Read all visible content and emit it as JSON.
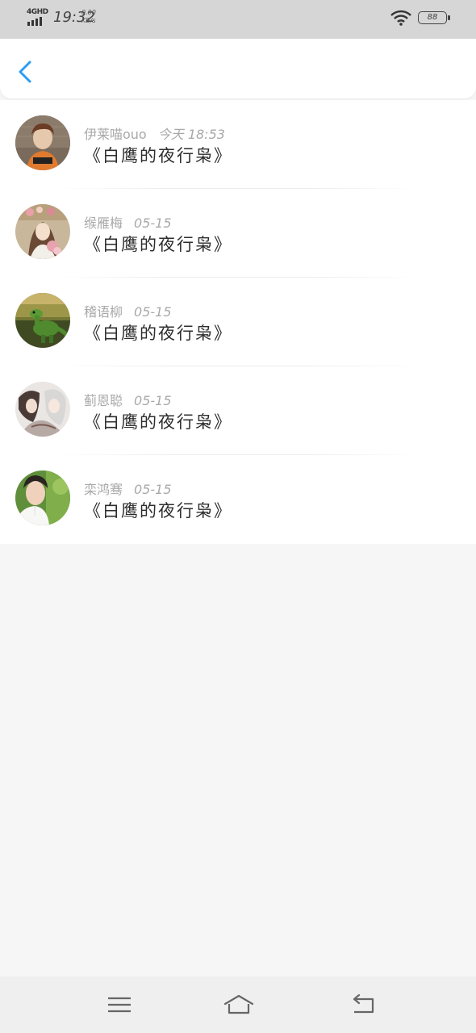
{
  "status_bar": {
    "network": "4GHD",
    "time": "19:32",
    "speed_value": "0.00",
    "speed_unit": "KB/s",
    "battery": "88"
  },
  "colors": {
    "accent": "#2a9df4",
    "status_bar_bg": "#d6d6d6",
    "page_bg": "#f7f6f6"
  },
  "header": {
    "back_icon": "chevron-left-icon"
  },
  "items": [
    {
      "name": "伊莱喵ouo",
      "time": "今天 18:53",
      "title": "《白鹰的夜行枭》",
      "avatar": "avatar-boy-mugshot"
    },
    {
      "name": "缑雁梅",
      "time": "05-15",
      "title": "《白鹰的夜行枭》",
      "avatar": "avatar-girl-flowers"
    },
    {
      "name": "稽语柳",
      "time": "05-15",
      "title": "《白鹰的夜行枭》",
      "avatar": "avatar-green-dinosaur"
    },
    {
      "name": "蓟恩聪",
      "time": "05-15",
      "title": "《白鹰的夜行枭》",
      "avatar": "avatar-anime-couple"
    },
    {
      "name": "栾鸿骞",
      "time": "05-15",
      "title": "《白鹰的夜行枭》",
      "avatar": "avatar-young-man"
    }
  ],
  "bottom_nav": {
    "menu_icon": "menu-icon",
    "home_icon": "home-icon",
    "back_icon": "back-arrow-icon"
  }
}
